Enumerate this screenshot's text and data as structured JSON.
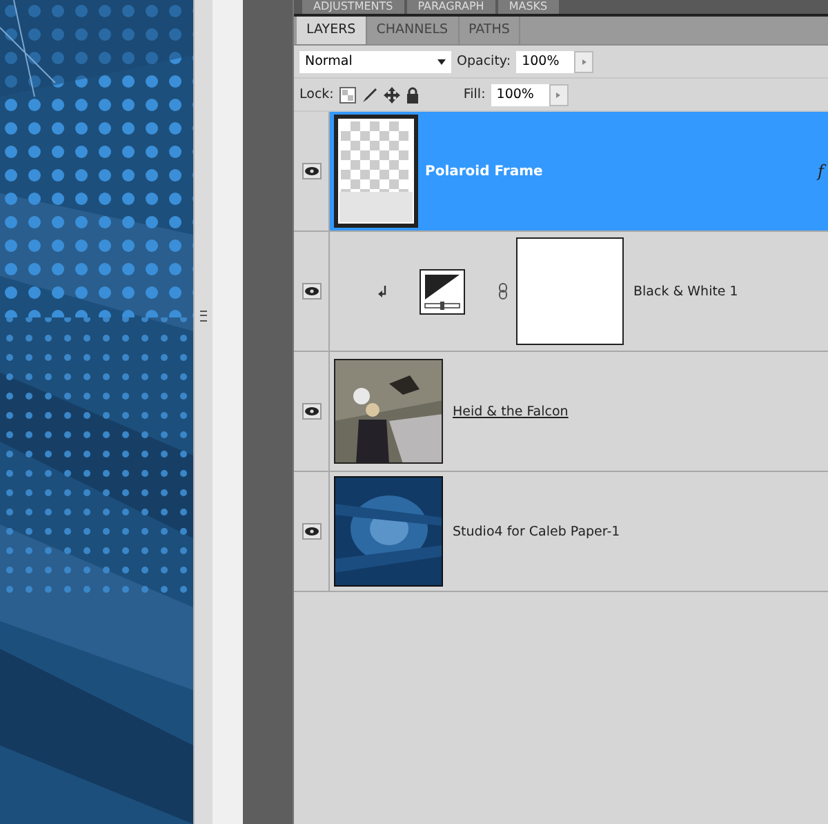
{
  "top_tabs": [
    {
      "label": "ADJUSTMENTS"
    },
    {
      "label": "PARAGRAPH"
    },
    {
      "label": "MASKS"
    }
  ],
  "tabs": [
    {
      "label": "LAYERS",
      "selected": true
    },
    {
      "label": "CHANNELS",
      "selected": false
    },
    {
      "label": "PATHS",
      "selected": false
    }
  ],
  "blend_mode": "Normal",
  "opacity": {
    "label": "Opacity:",
    "value": "100%"
  },
  "lock": {
    "label": "Lock:"
  },
  "fill": {
    "label": "Fill:",
    "value": "100%"
  },
  "layers": [
    {
      "kind": "frame",
      "name": "Polaroid Frame",
      "selected": true,
      "visible": true,
      "effects": "f"
    },
    {
      "kind": "adjustment",
      "name": "Black & White 1",
      "selected": false,
      "visible": true,
      "clipped": true
    },
    {
      "name": "Heid & the Falcon",
      "selected": false,
      "visible": true,
      "clip_base": true
    },
    {
      "kind": "paper",
      "name": "Studio4 for Caleb Paper-1",
      "selected": false,
      "visible": true
    }
  ]
}
